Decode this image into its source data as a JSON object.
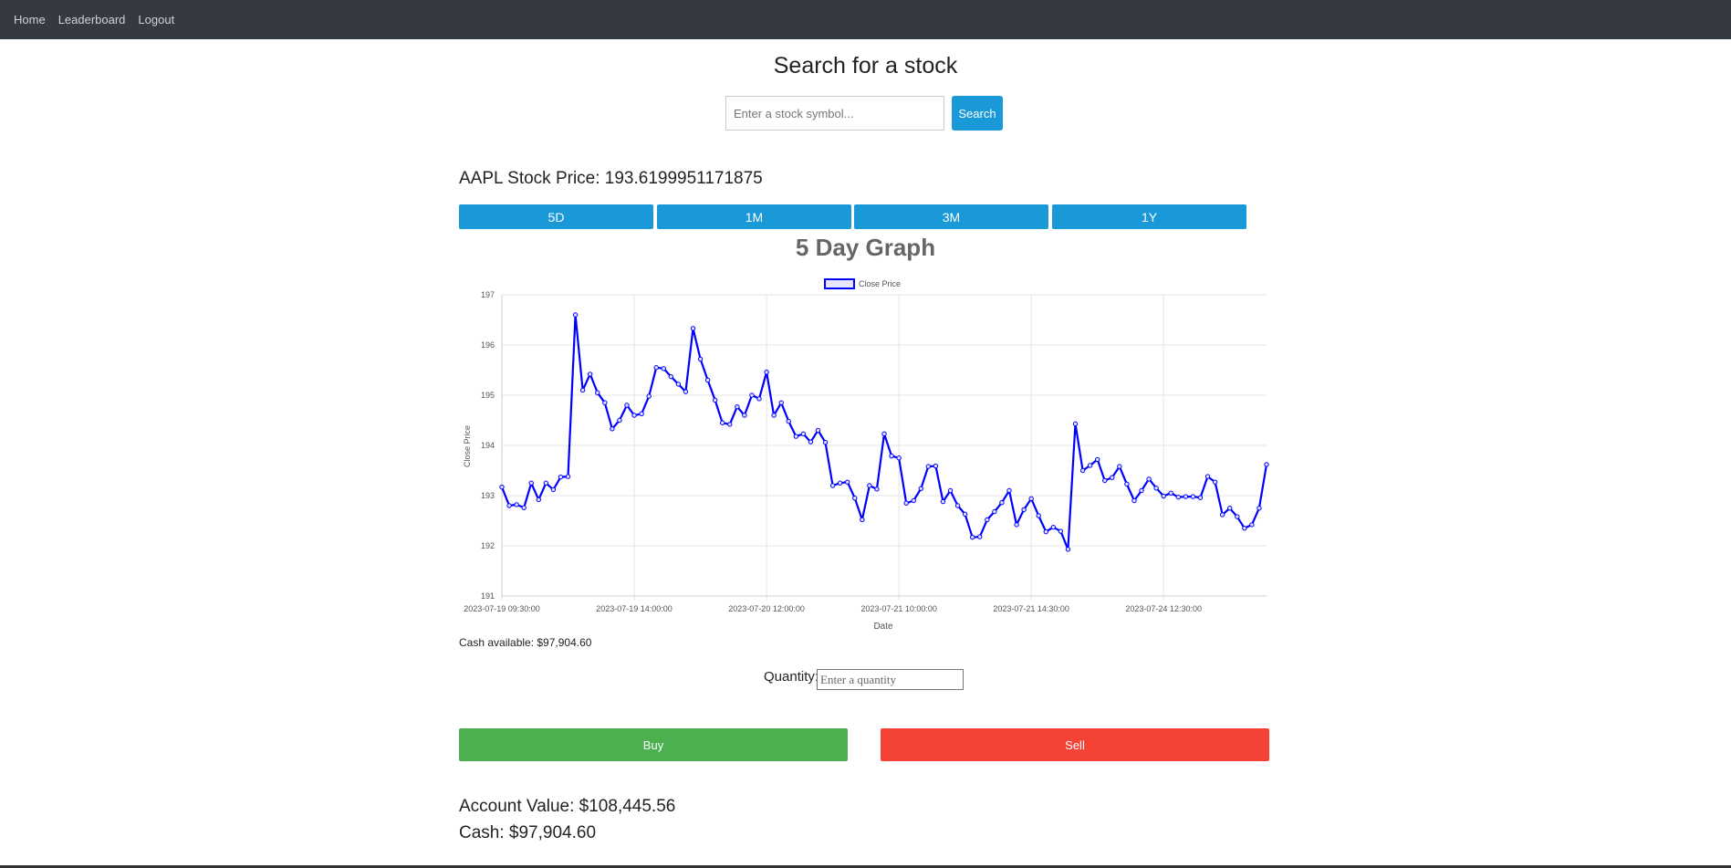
{
  "nav": {
    "home": "Home",
    "leaderboard": "Leaderboard",
    "logout": "Logout"
  },
  "search": {
    "title": "Search for a stock",
    "placeholder": "Enter a stock symbol...",
    "button": "Search"
  },
  "stock": {
    "price_line": "AAPL Stock Price: 193.6199951171875"
  },
  "ranges": [
    "5D",
    "1M",
    "3M",
    "1Y"
  ],
  "graph": {
    "title": "5 Day Graph"
  },
  "chart_data": {
    "type": "line",
    "legend": "top-center",
    "grid": true,
    "line_color": "#0000ff",
    "xlabel": "Date",
    "ylabel": "Close Price",
    "ylim": [
      191,
      197
    ],
    "y_ticks": [
      191,
      192,
      193,
      194,
      195,
      196,
      197
    ],
    "x_tick_labels": [
      "2023-07-19 09:30:00",
      "2023-07-19 14:00:00",
      "2023-07-20 12:00:00",
      "2023-07-21 10:00:00",
      "2023-07-21 14:30:00",
      "2023-07-24 12:30:00"
    ],
    "x_tick_indices": [
      0,
      18,
      36,
      54,
      72,
      90
    ],
    "series": [
      {
        "name": "Close Price",
        "values": [
          193.17,
          192.8,
          192.82,
          192.76,
          193.25,
          192.92,
          193.25,
          193.12,
          193.37,
          193.38,
          196.6,
          195.1,
          195.42,
          195.05,
          194.85,
          194.33,
          194.5,
          194.8,
          194.6,
          194.63,
          194.98,
          195.55,
          195.53,
          195.37,
          195.22,
          195.07,
          196.33,
          195.72,
          195.3,
          194.9,
          194.45,
          194.42,
          194.77,
          194.6,
          195.0,
          194.93,
          195.46,
          194.6,
          194.85,
          194.48,
          194.18,
          194.23,
          194.07,
          194.3,
          194.06,
          193.2,
          193.25,
          193.27,
          192.95,
          192.52,
          193.2,
          193.13,
          194.23,
          193.79,
          193.75,
          192.85,
          192.9,
          193.14,
          193.58,
          193.59,
          192.88,
          193.1,
          192.8,
          192.63,
          192.17,
          192.18,
          192.52,
          192.68,
          192.86,
          193.1,
          192.42,
          192.72,
          192.94,
          192.6,
          192.28,
          192.37,
          192.29,
          191.93,
          194.43,
          193.5,
          193.6,
          193.72,
          193.3,
          193.36,
          193.58,
          193.23,
          192.9,
          193.1,
          193.33,
          193.15,
          192.99,
          193.05,
          192.97,
          192.98,
          192.98,
          192.96,
          193.38,
          193.27,
          192.62,
          192.75,
          192.58,
          192.35,
          192.42,
          192.75,
          193.62
        ]
      }
    ]
  },
  "trade": {
    "cash_available": "Cash available: $97,904.60",
    "quantity_label": "Quantity:",
    "quantity_placeholder": "Enter a quantity",
    "buy": "Buy",
    "sell": "Sell"
  },
  "account": {
    "value_line": "Account Value: $108,445.56",
    "cash_line": "Cash: $97,904.60"
  }
}
